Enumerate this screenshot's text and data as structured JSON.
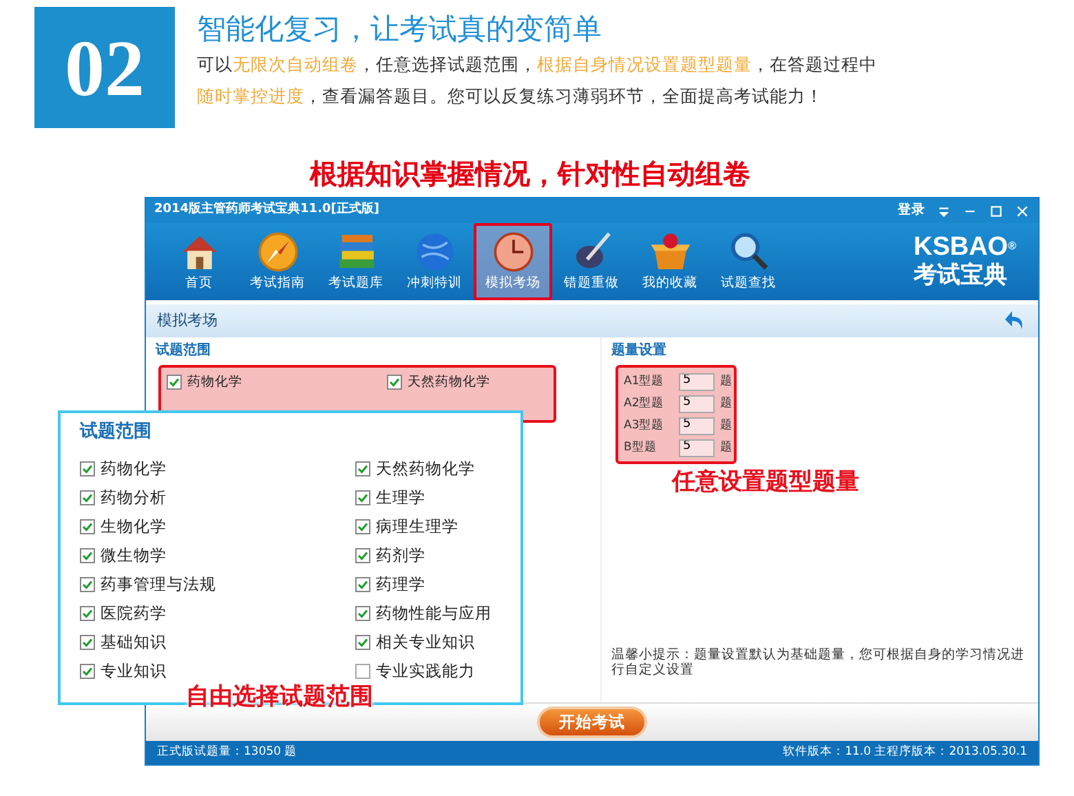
{
  "banner": {
    "number": "02",
    "title": "智能化复习，让考试真的变简单",
    "lines": [
      [
        {
          "text": "可以",
          "highlight": false
        },
        {
          "text": "无限次自动组卷",
          "highlight": true
        },
        {
          "text": "，任意选择试题范围，",
          "highlight": false
        },
        {
          "text": "根据自身情况设置题型题量",
          "highlight": true
        },
        {
          "text": "，在答题过程中",
          "highlight": false
        }
      ],
      [
        {
          "text": "随时掌控进度",
          "highlight": true
        },
        {
          "text": "，查看漏答题目。您可以反复练习薄弱环节，全面提高考试能力！",
          "highlight": false
        }
      ]
    ]
  },
  "headline": "根据知识掌握情况，针对性自动组卷",
  "window": {
    "title": "2014版主管药师考试宝典11.0[正式版]",
    "login": "登录",
    "toolbar": [
      {
        "label": "首页",
        "kind": "house",
        "selected": false
      },
      {
        "label": "考试指南",
        "kind": "compass",
        "selected": false
      },
      {
        "label": "考试题库",
        "kind": "books",
        "selected": false
      },
      {
        "label": "冲刺特训",
        "kind": "ball",
        "selected": false
      },
      {
        "label": "模拟考场",
        "kind": "clock",
        "selected": true
      },
      {
        "label": "错题重做",
        "kind": "pen",
        "selected": false
      },
      {
        "label": "我的收藏",
        "kind": "giftbox",
        "selected": false
      },
      {
        "label": "试题查找",
        "kind": "magnifier",
        "selected": false
      }
    ],
    "logo": {
      "brand": "KSBAO",
      "mark": "®",
      "name": "考试宝典"
    },
    "section_title": "模拟考场",
    "scope": {
      "heading": "试题范围",
      "items": [
        {
          "label": "药物化学",
          "checked": true
        },
        {
          "label": "天然药物化学",
          "checked": true
        }
      ]
    },
    "quantity": {
      "heading": "题量设置",
      "rows": [
        {
          "label": "A1型题",
          "value": "5",
          "unit": "题"
        },
        {
          "label": "A2型题",
          "value": "5",
          "unit": "题"
        },
        {
          "label": "A3型题",
          "value": "5",
          "unit": "题"
        },
        {
          "label": "B型题",
          "value": "5",
          "unit": "题"
        }
      ]
    },
    "tip": "温馨小提示：题量设置默认为基础题量，您可根据自身的学习情况进行自定义设置",
    "start_button": "开始考试",
    "status_left": "正式版试题量：13050 题",
    "status_right": "软件版本：11.0 主程序版本：2013.05.30.1"
  },
  "popup": {
    "heading": "试题范围",
    "items": [
      {
        "label": "药物化学",
        "checked": true
      },
      {
        "label": "天然药物化学",
        "checked": true
      },
      {
        "label": "药物分析",
        "checked": true
      },
      {
        "label": "生理学",
        "checked": true
      },
      {
        "label": "生物化学",
        "checked": true
      },
      {
        "label": "病理生理学",
        "checked": true
      },
      {
        "label": "微生物学",
        "checked": true
      },
      {
        "label": "药剂学",
        "checked": true
      },
      {
        "label": "药事管理与法规",
        "checked": true
      },
      {
        "label": "药理学",
        "checked": true
      },
      {
        "label": "医院药学",
        "checked": true
      },
      {
        "label": "药物性能与应用",
        "checked": true
      },
      {
        "label": "基础知识",
        "checked": true
      },
      {
        "label": "相关专业知识",
        "checked": true
      },
      {
        "label": "专业知识",
        "checked": true
      },
      {
        "label": "专业实践能力",
        "checked": false
      }
    ]
  },
  "callouts": [
    {
      "text": "任意设置题型题量"
    },
    {
      "text": "自由选择试题范围"
    }
  ]
}
